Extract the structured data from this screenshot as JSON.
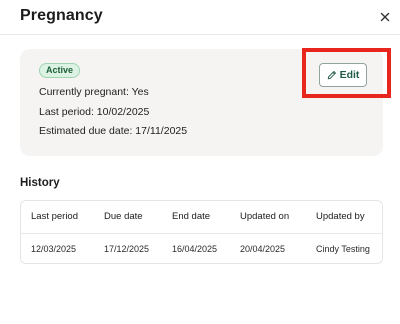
{
  "dialog": {
    "title": "Pregnancy",
    "close_icon": "close-icon"
  },
  "status": {
    "badge": "Active",
    "currently_pregnant": "Currently pregnant: Yes",
    "last_period": "Last period: 10/02/2025",
    "estimated_due_date": "Estimated due date: 17/11/2025",
    "edit_label": "Edit",
    "edit_icon": "pencil-icon"
  },
  "history": {
    "title": "History",
    "columns": [
      "Last period",
      "Due date",
      "End date",
      "Updated on",
      "Updated by"
    ],
    "rows": [
      [
        "12/03/2025",
        "17/12/2025",
        "16/04/2025",
        "20/04/2025",
        "Cindy Testing"
      ]
    ]
  },
  "colors": {
    "badge_bg": "#dcf3e3",
    "badge_text": "#20603a",
    "edit_text": "#1f5a48",
    "highlight": "#e8261d",
    "card_bg": "#f5f4f2"
  }
}
